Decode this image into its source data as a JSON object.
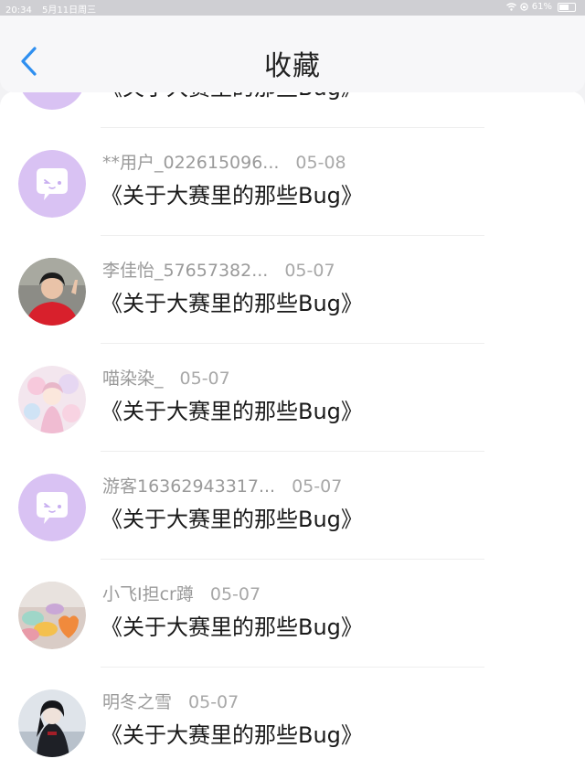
{
  "status": {
    "time": "20:34",
    "date": "5月11日周三",
    "battery": "61%",
    "battery_level": 0.61
  },
  "nav": {
    "title": "收藏",
    "back_icon": "chevron-left-icon"
  },
  "colors": {
    "accent": "#2f8ff0",
    "default_avatar": "#d9c2f3"
  },
  "items": [
    {
      "user": "**用户_022615096...",
      "date": "05-08",
      "title": "《关于大赛里的那些Bug》",
      "avatar": "default-chat-avatar"
    },
    {
      "user": "李佳怡_57657382...",
      "date": "05-07",
      "title": "《关于大赛里的那些Bug》",
      "avatar": "photo-woman-red"
    },
    {
      "user": "喵染染_",
      "date": "05-07",
      "title": "《关于大赛里的那些Bug》",
      "avatar": "anime-girl-pastel"
    },
    {
      "user": "游客16362943317...",
      "date": "05-07",
      "title": "《关于大赛里的那些Bug》",
      "avatar": "default-chat-avatar"
    },
    {
      "user": "小飞I担cr蹲",
      "date": "05-07",
      "title": "《关于大赛里的那些Bug》",
      "avatar": "candy-hearts"
    },
    {
      "user": "明冬之雪",
      "date": "05-07",
      "title": "《关于大赛里的那些Bug》",
      "avatar": "anime-dark-figure"
    }
  ]
}
